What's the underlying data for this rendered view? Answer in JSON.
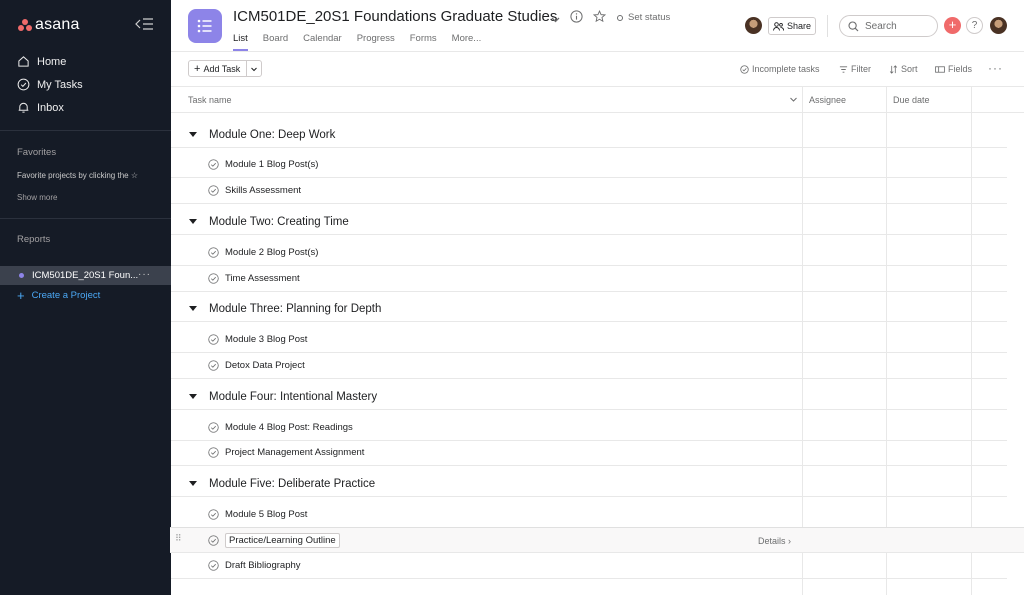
{
  "sidebar": {
    "logo": "asana",
    "nav": [
      {
        "label": "Home",
        "icon": "home-icon"
      },
      {
        "label": "My Tasks",
        "icon": "check-circle-icon"
      },
      {
        "label": "Inbox",
        "icon": "bell-icon"
      }
    ],
    "favorites_title": "Favorites",
    "favorites_hint": "Favorite projects by clicking the ☆",
    "show_more": "Show more",
    "reports_title": "Reports",
    "active_project": "ICM501DE_20S1 Foun...",
    "project_more": "···",
    "create_project": "Create a Project"
  },
  "header": {
    "title": "ICM501DE_20S1 Foundations Graduate Studies",
    "set_status": "Set status",
    "tabs": [
      "List",
      "Board",
      "Calendar",
      "Progress",
      "Forms",
      "More..."
    ],
    "active_tab": "List",
    "share": "Share",
    "search_placeholder": "Search",
    "help": "?",
    "plus": "+"
  },
  "toolbar": {
    "add_task": "Add Task",
    "incomplete": "Incomplete tasks",
    "filter": "Filter",
    "sort": "Sort",
    "fields": "Fields",
    "more": "···"
  },
  "columns": {
    "task_name": "Task name",
    "assignee": "Assignee",
    "due_date": "Due date"
  },
  "sections": [
    {
      "title": "Module One: Deep Work",
      "tasks": [
        "Module 1 Blog Post(s)",
        "Skills Assessment"
      ]
    },
    {
      "title": "Module Two: Creating Time",
      "tasks": [
        "Module 2 Blog Post(s)",
        "Time Assessment"
      ]
    },
    {
      "title": "Module Three: Planning for Depth",
      "tasks": [
        "Module 3 Blog Post",
        "Detox Data Project"
      ]
    },
    {
      "title": "Module Four: Intentional Mastery",
      "tasks": [
        "Module 4 Blog Post: Readings",
        "Project Management Assignment"
      ]
    },
    {
      "title": "Module Five: Deliberate Practice",
      "tasks": [
        "Module 5 Blog Post",
        "Practice/Learning Outline",
        "Draft Bibliography"
      ]
    }
  ],
  "hover_row": {
    "details": "Details ›"
  },
  "colors": {
    "sidebar_bg": "#151b26",
    "accent": "#8d84e8",
    "brand": "#f06a6a",
    "link": "#4ba8f5"
  }
}
